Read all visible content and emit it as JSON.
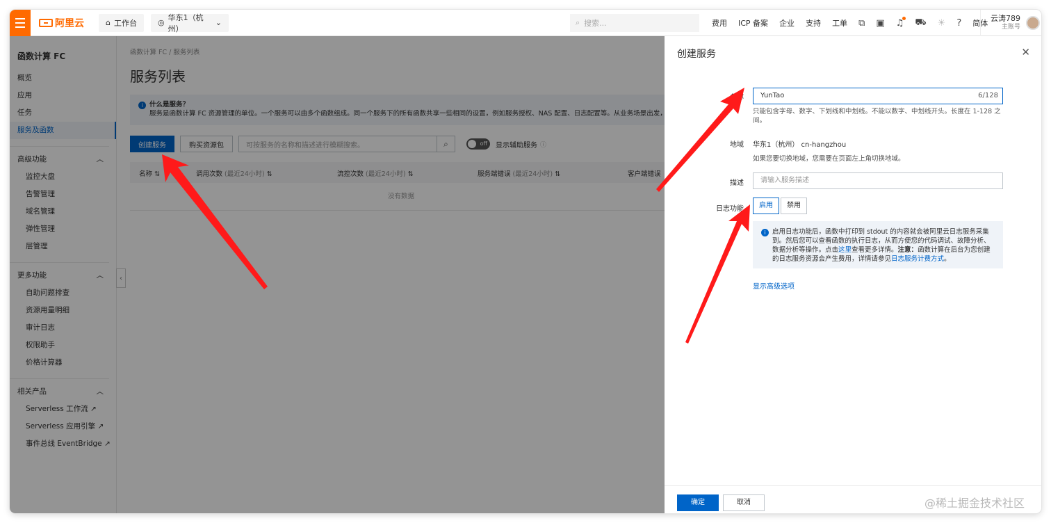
{
  "topbar": {
    "logo_text": "阿里云",
    "workbench": "工作台",
    "region": "华东1（杭州）",
    "search_placeholder": "搜索...",
    "links": [
      "费用",
      "ICP 备案",
      "企业",
      "支持",
      "工单"
    ],
    "lang": "简体",
    "user_name": "云涛789",
    "user_role": "主账号",
    "accent_color": "#ff6a00"
  },
  "sidebar": {
    "title": "函数计算 FC",
    "items": [
      "概览",
      "应用",
      "任务",
      "服务及函数"
    ],
    "active_item": "服务及函数",
    "groups": [
      {
        "label": "高级功能",
        "items": [
          "监控大盘",
          "告警管理",
          "域名管理",
          "弹性管理",
          "层管理"
        ]
      },
      {
        "label": "更多功能",
        "items": [
          "自助问题排查",
          "资源用量明细",
          "审计日志",
          "权限助手",
          "价格计算器"
        ]
      },
      {
        "label": "相关产品",
        "items": [
          "Serverless 工作流",
          "Serverless 应用引擎",
          "事件总线 EventBridge"
        ]
      }
    ]
  },
  "main": {
    "breadcrumb": [
      "函数计算 FC",
      "/",
      "服务列表"
    ],
    "title": "服务列表",
    "info_title": "什么是服务？",
    "info_text": "服务是函数计算 FC 资源管理的单位。一个服务可以由多个函数组成。同一个服务下的所有函数共享一些相同的设置，例如服务授权、NAS 配置、日志配置等。从业务场景出发，一",
    "create_button": "创建服务",
    "buy_button": "购买资源包",
    "search_placeholder": "可按服务的名称和描述进行模糊搜索。",
    "toggle_text": "off",
    "toggle_label": "显示辅助服务",
    "columns": [
      {
        "label": "名称",
        "muted": ""
      },
      {
        "label": "调用次数",
        "muted": "(最近24小时)"
      },
      {
        "label": "流控次数",
        "muted": "(最近24小时)"
      },
      {
        "label": "服务端错误",
        "muted": "(最近24小时)"
      },
      {
        "label": "客户端错误",
        "muted": ""
      }
    ],
    "empty_text": "没有数据"
  },
  "panel": {
    "title": "创建服务",
    "name_label": "名称",
    "name_value": "YunTao",
    "name_count": "6/128",
    "name_help": "只能包含字母、数字、下划线和中划线。不能以数字、中划线开头。长度在 1-128 之间。",
    "region_label": "地域",
    "region_value": "华东1（杭州） cn-hangzhou",
    "region_help": "如果您要切换地域，您需要在页面左上角切换地域。",
    "desc_label": "描述",
    "desc_placeholder": "请输入服务描述",
    "log_label": "日志功能",
    "log_enable": "启用",
    "log_disable": "禁用",
    "log_info_1": "启用日志功能后，函数中打印到 stdout 的内容就会被阿里云日志服务采集到。然后您可以查看函数的执行日志，从而方便您的代码调试、故障分析、数据分析等操作。点击",
    "log_info_link1": "这里",
    "log_info_2": "查看更多详情。",
    "log_info_note": "注意：",
    "log_info_3": "函数计算在后台为您创建的日志服务资源会产生费用，详情请参见",
    "log_info_link2": "日志服务计费方式",
    "log_info_4": "。",
    "advanced": "显示高级选项",
    "ok": "确定",
    "cancel": "取消"
  },
  "watermark": "@稀土掘金技术社区"
}
